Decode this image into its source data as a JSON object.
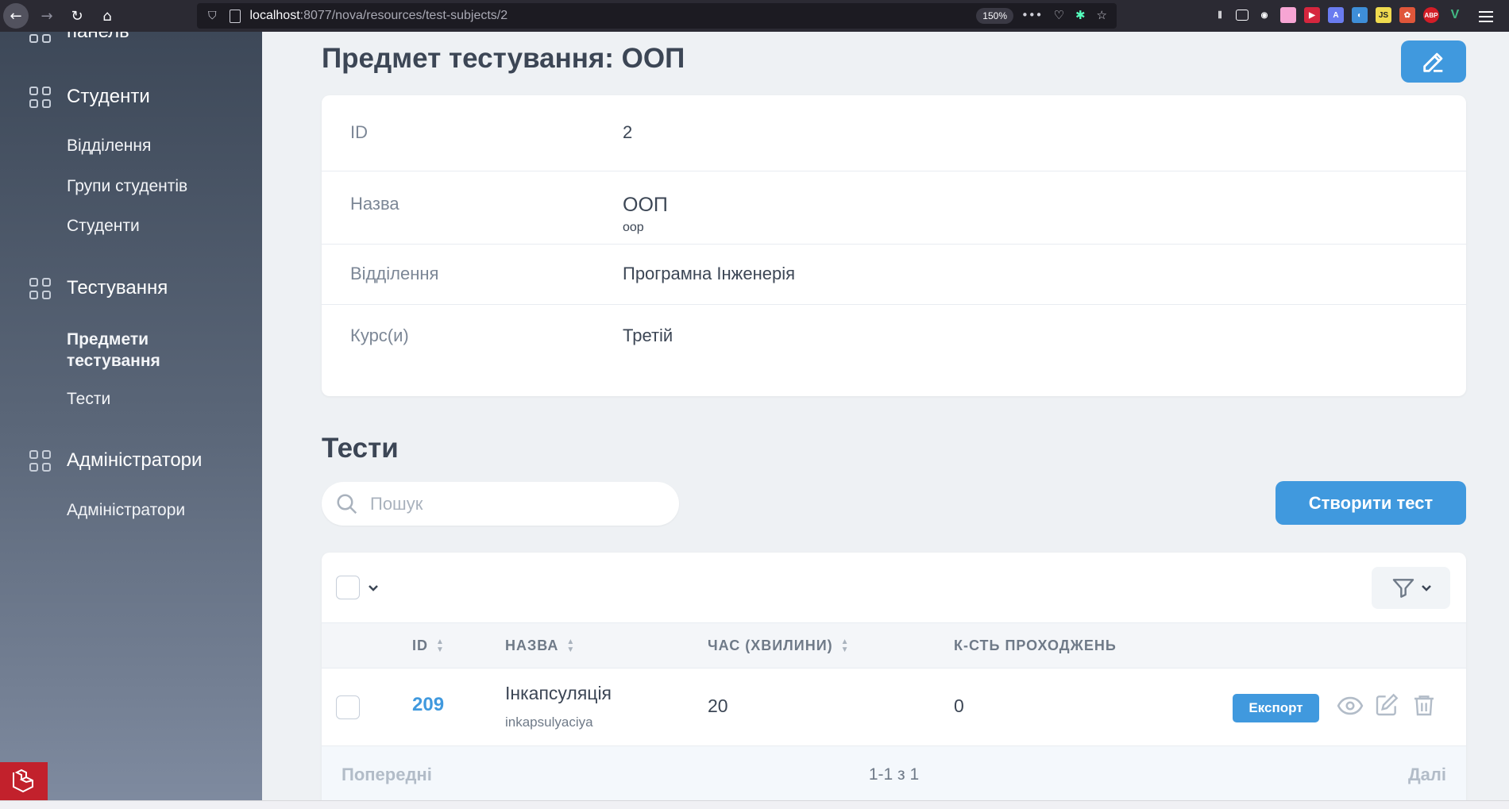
{
  "browser": {
    "url_host": "localhost",
    "url_path": ":8077/nova/resources/test-subjects/2",
    "zoom": "150%"
  },
  "sidebar": {
    "partial_top_label": "панель",
    "groups": [
      {
        "label": "Студенти",
        "items": [
          "Відділення",
          "Групи студентів",
          "Студенти"
        ]
      },
      {
        "label": "Тестування",
        "items": [
          "Предмети тестування",
          "Тести"
        ]
      },
      {
        "label": "Адміністратори",
        "items": [
          "Адміністратори"
        ]
      }
    ],
    "active_item": "Предмети тестування"
  },
  "page": {
    "title": "Предмет тестування: ООП"
  },
  "details": [
    {
      "key": "ID",
      "value": "2"
    },
    {
      "key": "Назва",
      "value": "ООП",
      "sub": "oop"
    },
    {
      "key": "Відділення",
      "value": "Програмна Інженерія"
    },
    {
      "key": "Курс(и)",
      "value": "Третій"
    }
  ],
  "tests": {
    "title": "Тести",
    "search_placeholder": "Пошук",
    "create_label": "Створити тест",
    "columns": [
      "ID",
      "НАЗВА",
      "ЧАС (ХВИЛИНИ)",
      "К-СТЬ ПРОХОДЖЕНЬ"
    ],
    "rows": [
      {
        "id": "209",
        "name": "Інкапсуляція",
        "slug": "inkapsulyaciya",
        "time": "20",
        "count": "0",
        "export_label": "Експорт"
      }
    ],
    "pager": {
      "prev": "Попередні",
      "info": "1-1 з 1",
      "next": "Далі"
    }
  },
  "colors": {
    "accent": "#4099de",
    "sidebar_top": "#3d4858",
    "background": "#eef1f4"
  },
  "icons": [
    "back-icon",
    "forward-icon",
    "reload-icon",
    "home-icon",
    "edit-icon",
    "search-icon",
    "filter-icon",
    "eye-icon",
    "trash-icon",
    "grid-icon"
  ]
}
